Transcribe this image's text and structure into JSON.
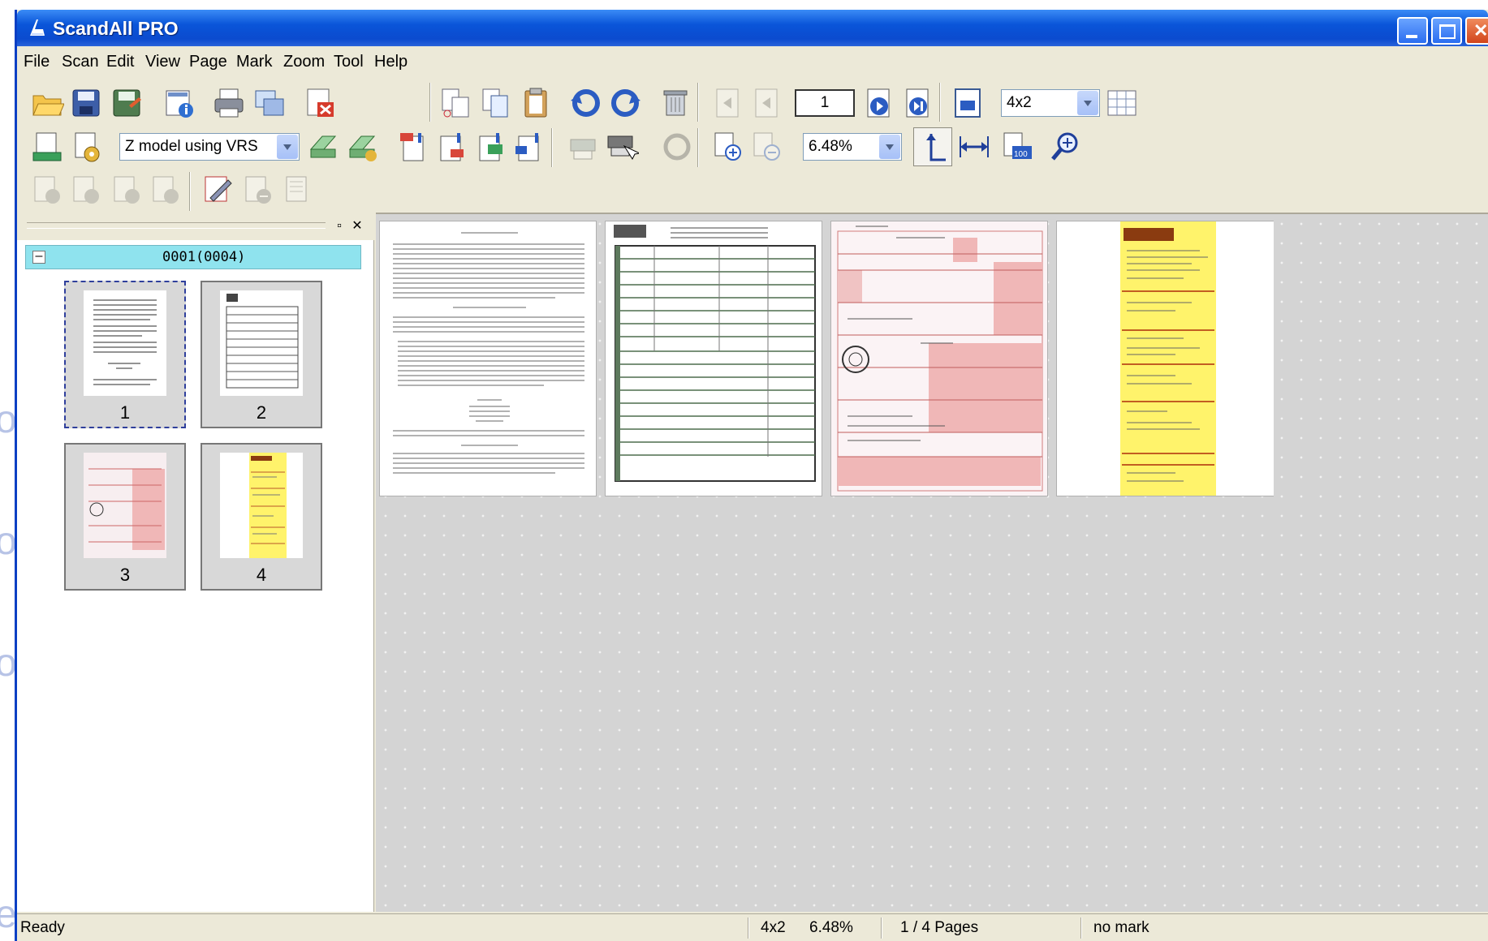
{
  "window": {
    "title": "ScandAll PRO"
  },
  "menu": [
    "File",
    "Scan",
    "Edit",
    "View",
    "Page",
    "Mark",
    "Zoom",
    "Tool",
    "Help"
  ],
  "toolbar": {
    "profile_select": "Z model using VRS",
    "page_number": "1",
    "layout_select": "4x2",
    "zoom_select": "6.48%"
  },
  "left_panel": {
    "group_label": "0001(0004)",
    "thumbnails": [
      {
        "label": "1",
        "selected": true
      },
      {
        "label": "2",
        "selected": false
      },
      {
        "label": "3",
        "selected": false
      },
      {
        "label": "4",
        "selected": false
      }
    ]
  },
  "status": {
    "text": "Ready",
    "layout": "4x2",
    "zoom": "6.48%",
    "pages": "1 / 4 Pages",
    "mark": "no mark"
  },
  "colors": {
    "titlebar": "#0a55d9",
    "group_header": "#8fe3ee",
    "chrome": "#ece9d8",
    "viewer_bg": "#d4d4d4",
    "yellow_form": "#fff36b",
    "pink_form": "#f0b7b7"
  }
}
